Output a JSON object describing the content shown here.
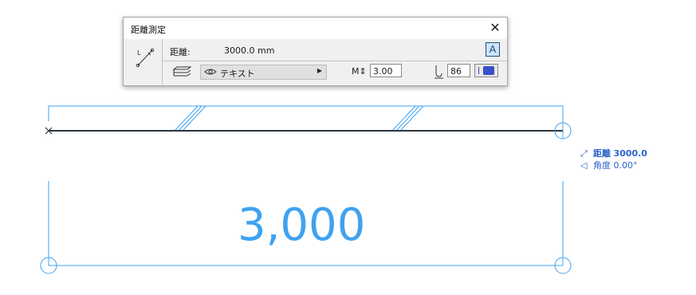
{
  "palette": {
    "title": "距離測定",
    "distance_label": "距離:",
    "distance_value": "3000.0 mm",
    "auto_text_toggle": "A",
    "layer_name": "テキスト",
    "pen_weight_label": "M",
    "pen_weight_value": "3.00",
    "pen_number_value": "86",
    "accent_color": "#3a4fc9"
  },
  "tracker": {
    "distance_label": "距離",
    "distance_value": "3000.0",
    "angle_label": "角度",
    "angle_value": "0.00°"
  },
  "dimension": {
    "value_text": "3,000",
    "color": "#3fa2f0"
  },
  "icons": {
    "close": "close-icon",
    "tool": "measure-tool-icon",
    "layer": "layer-icon",
    "eye": "eye-icon",
    "pen": "pen-icon",
    "distance": "distance-icon",
    "angle": "angle-icon"
  }
}
